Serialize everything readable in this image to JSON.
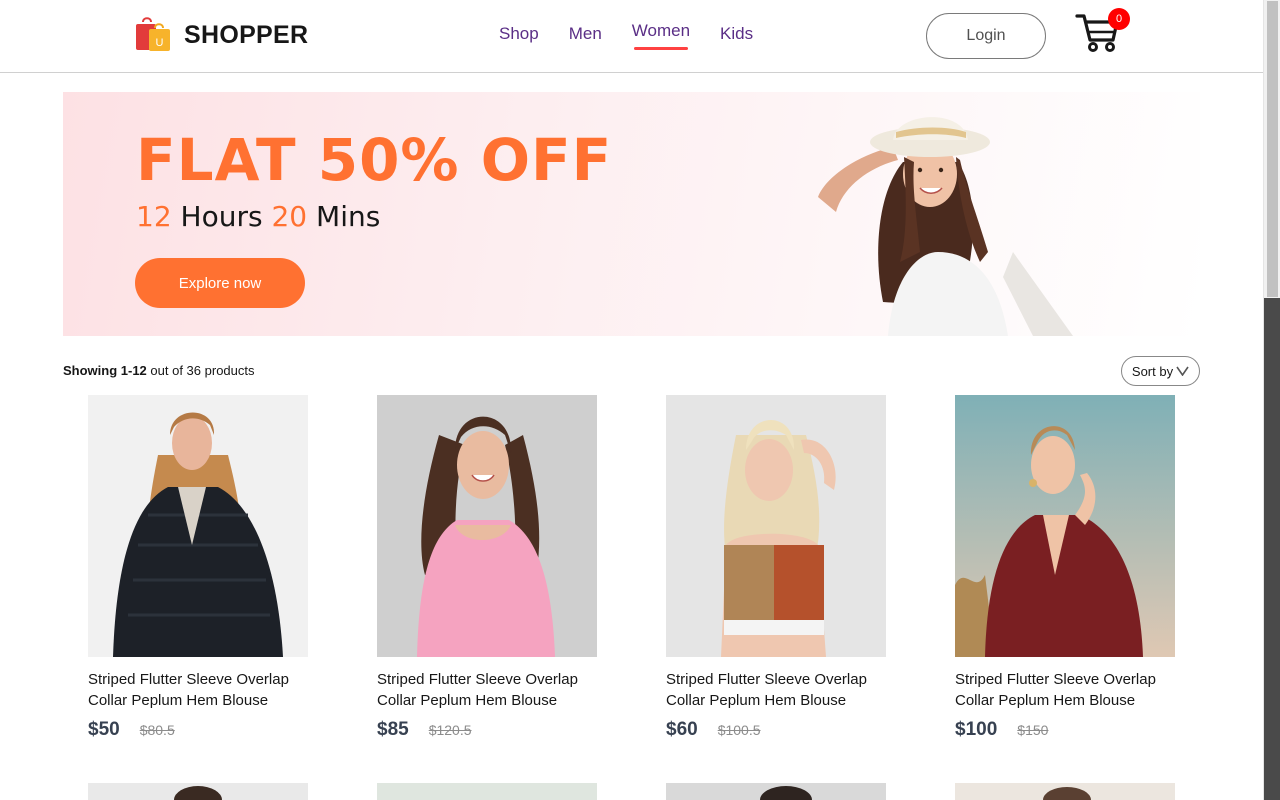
{
  "navbar": {
    "brand": "SHOPPER",
    "logo_badge": "U",
    "menu": [
      {
        "label": "Shop",
        "active": false
      },
      {
        "label": "Men",
        "active": false
      },
      {
        "label": "Women",
        "active": true
      },
      {
        "label": "Kids",
        "active": false
      }
    ],
    "login_label": "Login",
    "cart_count": "0"
  },
  "banner": {
    "headline": "FLAT 50% OFF",
    "timer_hours": "12",
    "timer_hours_label": "Hours",
    "timer_mins": "20",
    "timer_mins_label": "Mins",
    "cta_label": "Explore now"
  },
  "listing": {
    "showing_range": "Showing 1-12",
    "showing_rest": "out of 36 products",
    "sort_label": "Sort by"
  },
  "products": [
    {
      "name": "Striped Flutter Sleeve Overlap Collar Peplum Hem Blouse",
      "new_price": "$50",
      "old_price": "$80.5"
    },
    {
      "name": "Striped Flutter Sleeve Overlap Collar Peplum Hem Blouse",
      "new_price": "$85",
      "old_price": "$120.5"
    },
    {
      "name": "Striped Flutter Sleeve Overlap Collar Peplum Hem Blouse",
      "new_price": "$60",
      "old_price": "$100.5"
    },
    {
      "name": "Striped Flutter Sleeve Overlap Collar Peplum Hem Blouse",
      "new_price": "$100",
      "old_price": "$150"
    }
  ],
  "colors": {
    "accent": "#ff7131",
    "active_underline": "#ff4141",
    "nav_text": "#5a2e86",
    "badge": "#ff0000"
  }
}
